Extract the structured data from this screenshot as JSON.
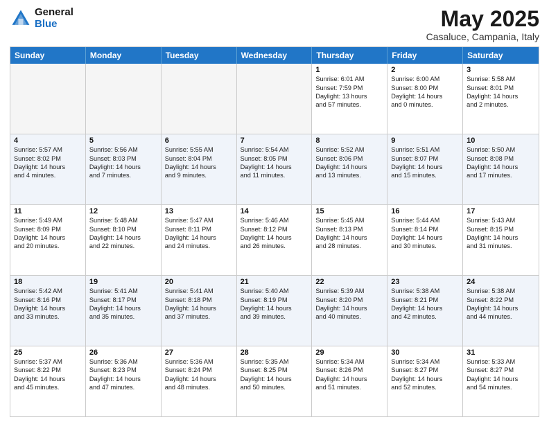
{
  "logo": {
    "general": "General",
    "blue": "Blue"
  },
  "header": {
    "month": "May 2025",
    "location": "Casaluce, Campania, Italy"
  },
  "weekdays": [
    "Sunday",
    "Monday",
    "Tuesday",
    "Wednesday",
    "Thursday",
    "Friday",
    "Saturday"
  ],
  "rows": [
    [
      {
        "day": "",
        "lines": [],
        "empty": true
      },
      {
        "day": "",
        "lines": [],
        "empty": true
      },
      {
        "day": "",
        "lines": [],
        "empty": true
      },
      {
        "day": "",
        "lines": [],
        "empty": true
      },
      {
        "day": "1",
        "lines": [
          "Sunrise: 6:01 AM",
          "Sunset: 7:59 PM",
          "Daylight: 13 hours",
          "and 57 minutes."
        ]
      },
      {
        "day": "2",
        "lines": [
          "Sunrise: 6:00 AM",
          "Sunset: 8:00 PM",
          "Daylight: 14 hours",
          "and 0 minutes."
        ]
      },
      {
        "day": "3",
        "lines": [
          "Sunrise: 5:58 AM",
          "Sunset: 8:01 PM",
          "Daylight: 14 hours",
          "and 2 minutes."
        ]
      }
    ],
    [
      {
        "day": "4",
        "lines": [
          "Sunrise: 5:57 AM",
          "Sunset: 8:02 PM",
          "Daylight: 14 hours",
          "and 4 minutes."
        ]
      },
      {
        "day": "5",
        "lines": [
          "Sunrise: 5:56 AM",
          "Sunset: 8:03 PM",
          "Daylight: 14 hours",
          "and 7 minutes."
        ]
      },
      {
        "day": "6",
        "lines": [
          "Sunrise: 5:55 AM",
          "Sunset: 8:04 PM",
          "Daylight: 14 hours",
          "and 9 minutes."
        ]
      },
      {
        "day": "7",
        "lines": [
          "Sunrise: 5:54 AM",
          "Sunset: 8:05 PM",
          "Daylight: 14 hours",
          "and 11 minutes."
        ]
      },
      {
        "day": "8",
        "lines": [
          "Sunrise: 5:52 AM",
          "Sunset: 8:06 PM",
          "Daylight: 14 hours",
          "and 13 minutes."
        ]
      },
      {
        "day": "9",
        "lines": [
          "Sunrise: 5:51 AM",
          "Sunset: 8:07 PM",
          "Daylight: 14 hours",
          "and 15 minutes."
        ]
      },
      {
        "day": "10",
        "lines": [
          "Sunrise: 5:50 AM",
          "Sunset: 8:08 PM",
          "Daylight: 14 hours",
          "and 17 minutes."
        ]
      }
    ],
    [
      {
        "day": "11",
        "lines": [
          "Sunrise: 5:49 AM",
          "Sunset: 8:09 PM",
          "Daylight: 14 hours",
          "and 20 minutes."
        ]
      },
      {
        "day": "12",
        "lines": [
          "Sunrise: 5:48 AM",
          "Sunset: 8:10 PM",
          "Daylight: 14 hours",
          "and 22 minutes."
        ]
      },
      {
        "day": "13",
        "lines": [
          "Sunrise: 5:47 AM",
          "Sunset: 8:11 PM",
          "Daylight: 14 hours",
          "and 24 minutes."
        ]
      },
      {
        "day": "14",
        "lines": [
          "Sunrise: 5:46 AM",
          "Sunset: 8:12 PM",
          "Daylight: 14 hours",
          "and 26 minutes."
        ]
      },
      {
        "day": "15",
        "lines": [
          "Sunrise: 5:45 AM",
          "Sunset: 8:13 PM",
          "Daylight: 14 hours",
          "and 28 minutes."
        ]
      },
      {
        "day": "16",
        "lines": [
          "Sunrise: 5:44 AM",
          "Sunset: 8:14 PM",
          "Daylight: 14 hours",
          "and 30 minutes."
        ]
      },
      {
        "day": "17",
        "lines": [
          "Sunrise: 5:43 AM",
          "Sunset: 8:15 PM",
          "Daylight: 14 hours",
          "and 31 minutes."
        ]
      }
    ],
    [
      {
        "day": "18",
        "lines": [
          "Sunrise: 5:42 AM",
          "Sunset: 8:16 PM",
          "Daylight: 14 hours",
          "and 33 minutes."
        ]
      },
      {
        "day": "19",
        "lines": [
          "Sunrise: 5:41 AM",
          "Sunset: 8:17 PM",
          "Daylight: 14 hours",
          "and 35 minutes."
        ]
      },
      {
        "day": "20",
        "lines": [
          "Sunrise: 5:41 AM",
          "Sunset: 8:18 PM",
          "Daylight: 14 hours",
          "and 37 minutes."
        ]
      },
      {
        "day": "21",
        "lines": [
          "Sunrise: 5:40 AM",
          "Sunset: 8:19 PM",
          "Daylight: 14 hours",
          "and 39 minutes."
        ]
      },
      {
        "day": "22",
        "lines": [
          "Sunrise: 5:39 AM",
          "Sunset: 8:20 PM",
          "Daylight: 14 hours",
          "and 40 minutes."
        ]
      },
      {
        "day": "23",
        "lines": [
          "Sunrise: 5:38 AM",
          "Sunset: 8:21 PM",
          "Daylight: 14 hours",
          "and 42 minutes."
        ]
      },
      {
        "day": "24",
        "lines": [
          "Sunrise: 5:38 AM",
          "Sunset: 8:22 PM",
          "Daylight: 14 hours",
          "and 44 minutes."
        ]
      }
    ],
    [
      {
        "day": "25",
        "lines": [
          "Sunrise: 5:37 AM",
          "Sunset: 8:22 PM",
          "Daylight: 14 hours",
          "and 45 minutes."
        ]
      },
      {
        "day": "26",
        "lines": [
          "Sunrise: 5:36 AM",
          "Sunset: 8:23 PM",
          "Daylight: 14 hours",
          "and 47 minutes."
        ]
      },
      {
        "day": "27",
        "lines": [
          "Sunrise: 5:36 AM",
          "Sunset: 8:24 PM",
          "Daylight: 14 hours",
          "and 48 minutes."
        ]
      },
      {
        "day": "28",
        "lines": [
          "Sunrise: 5:35 AM",
          "Sunset: 8:25 PM",
          "Daylight: 14 hours",
          "and 50 minutes."
        ]
      },
      {
        "day": "29",
        "lines": [
          "Sunrise: 5:34 AM",
          "Sunset: 8:26 PM",
          "Daylight: 14 hours",
          "and 51 minutes."
        ]
      },
      {
        "day": "30",
        "lines": [
          "Sunrise: 5:34 AM",
          "Sunset: 8:27 PM",
          "Daylight: 14 hours",
          "and 52 minutes."
        ]
      },
      {
        "day": "31",
        "lines": [
          "Sunrise: 5:33 AM",
          "Sunset: 8:27 PM",
          "Daylight: 14 hours",
          "and 54 minutes."
        ]
      }
    ]
  ]
}
